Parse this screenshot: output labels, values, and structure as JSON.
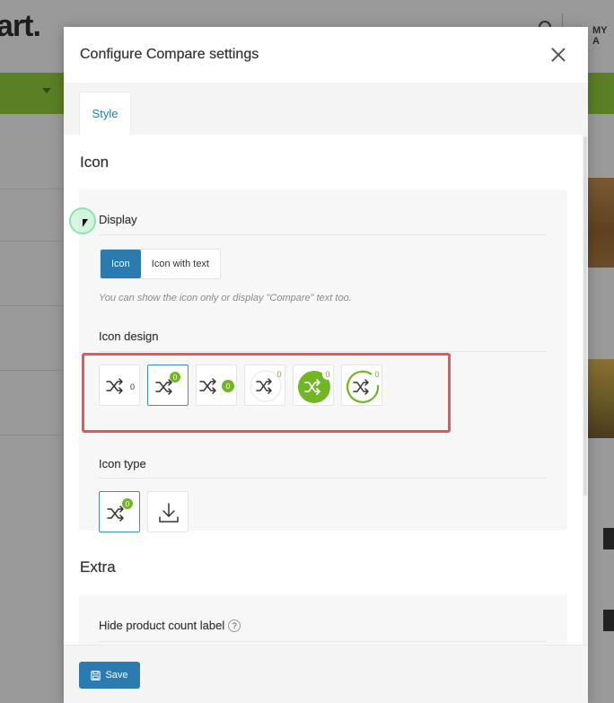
{
  "background": {
    "logo_text": "art.",
    "account_text": "MY A"
  },
  "modal": {
    "title": "Configure Compare settings",
    "tabs": [
      {
        "label": "Style",
        "active": true
      }
    ],
    "sections": {
      "icon": {
        "title": "Icon",
        "display": {
          "label": "Display",
          "options": [
            "Icon",
            "Icon with text"
          ],
          "selected": "Icon",
          "hint": "You can show the icon only or display \"Compare\" text too."
        },
        "icon_design": {
          "label": "Icon design",
          "count": "0",
          "options": [
            {
              "name": "design-plain-count"
            },
            {
              "name": "design-badge-corner",
              "selected": true
            },
            {
              "name": "design-badge-side"
            },
            {
              "name": "design-ring-light"
            },
            {
              "name": "design-filled-circle"
            },
            {
              "name": "design-ring-green"
            }
          ]
        },
        "icon_type": {
          "label": "Icon type",
          "count": "0",
          "options": [
            {
              "name": "shuffle-icon",
              "selected": true
            },
            {
              "name": "download-icon"
            }
          ]
        }
      },
      "extra": {
        "title": "Extra",
        "hide_count_label": "Hide product count label",
        "help_glyph": "?"
      }
    },
    "save_label": "Save"
  },
  "colors": {
    "accent": "#2b7bb0",
    "badge_green": "#72b626",
    "highlight": "#e65656"
  }
}
